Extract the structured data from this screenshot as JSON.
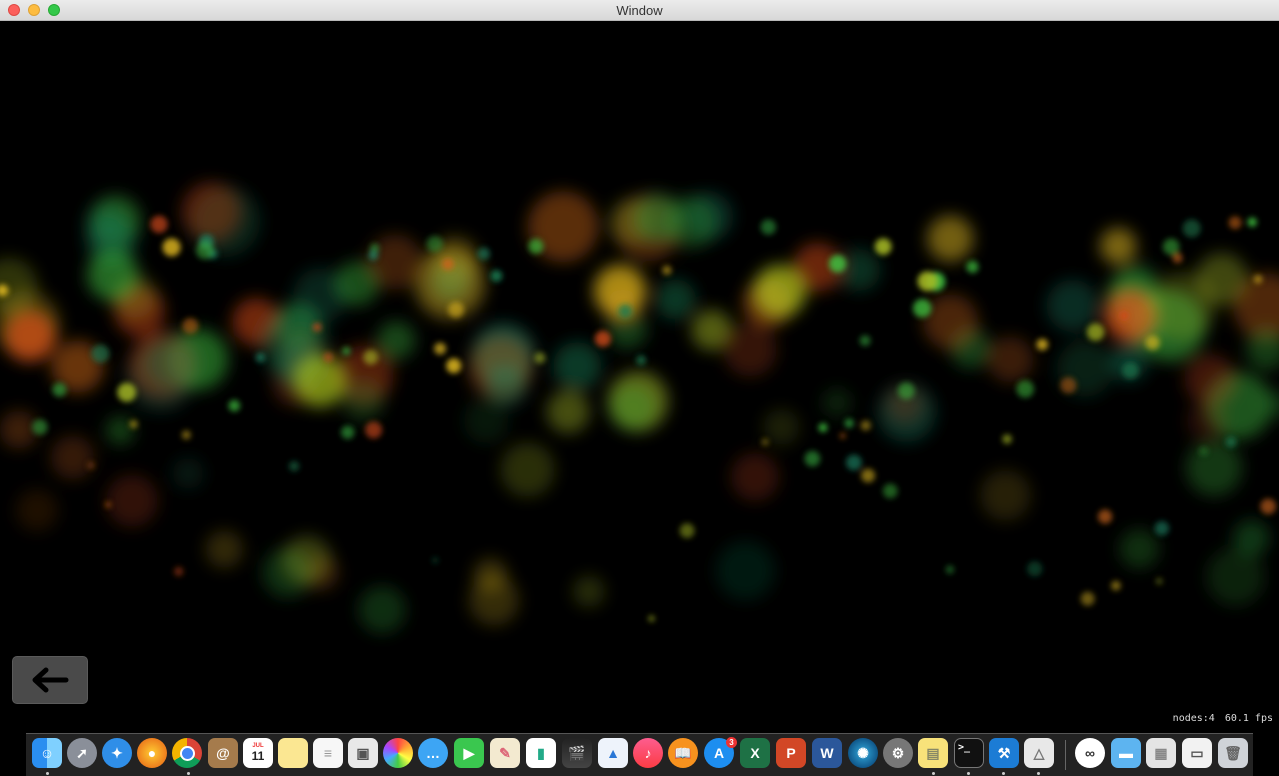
{
  "window": {
    "title": "Window"
  },
  "stats": {
    "nodes": "nodes:4",
    "fps": "60.1 fps"
  },
  "dock": {
    "calendar_month": "JUL",
    "calendar_day": "11",
    "appstore_badge": "3",
    "excel_letter": "X",
    "powerpoint_letter": "P",
    "word_letter": "W",
    "terminal_prompt": ">_"
  }
}
